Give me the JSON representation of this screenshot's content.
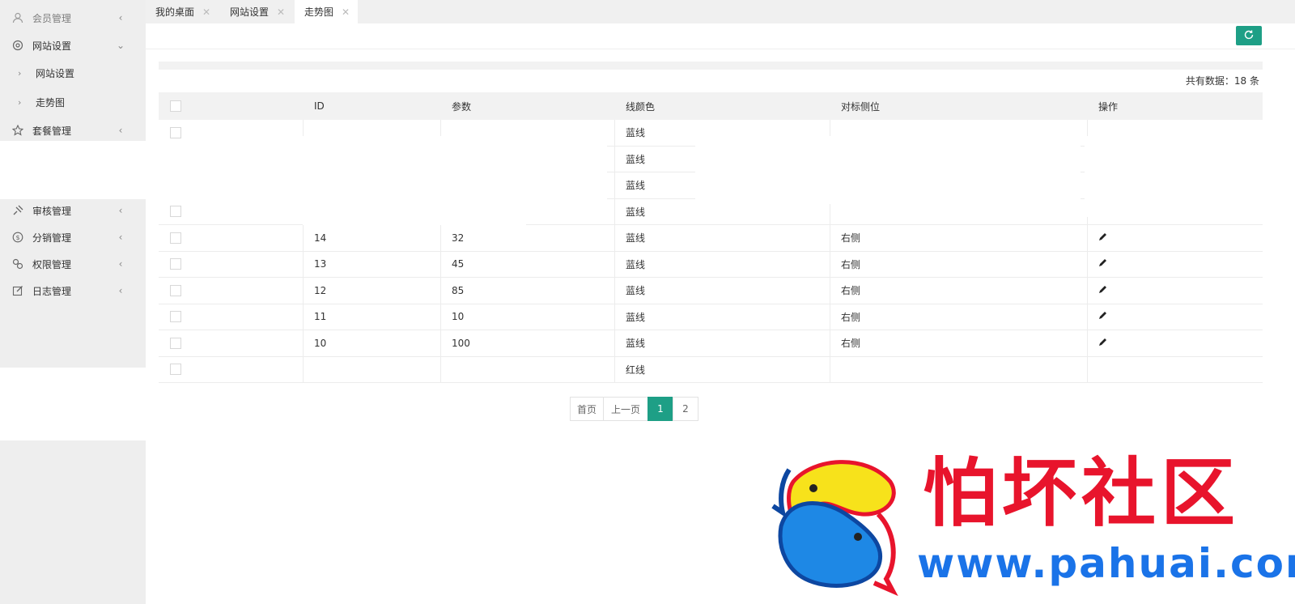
{
  "sidebar": {
    "items": [
      {
        "label": "会员管理",
        "icon": "user-icon"
      },
      {
        "label": "网站设置",
        "icon": "gear-icon",
        "expanded": true,
        "children": [
          {
            "label": "网站设置"
          },
          {
            "label": "走势图"
          }
        ]
      },
      {
        "label": "套餐管理",
        "icon": "star-icon"
      },
      {
        "label": "审核管理",
        "icon": "audit-icon"
      },
      {
        "label": "分销管理",
        "icon": "dollar-icon"
      },
      {
        "label": "权限管理",
        "icon": "link-icon"
      },
      {
        "label": "日志管理",
        "icon": "edit-log-icon"
      }
    ],
    "arrow_collapsed": "‹",
    "arrow_expanded": "⌄",
    "child_chevron": "›"
  },
  "tabs": [
    {
      "label": "我的桌面",
      "active": false
    },
    {
      "label": "网站设置",
      "active": false
    },
    {
      "label": "走势图",
      "active": true
    }
  ],
  "tab_close": "✕",
  "total_text": "共有数据：18 条",
  "table": {
    "headers": [
      "ID",
      "参数",
      "线颜色",
      "对标侧位",
      "操作"
    ],
    "rows": [
      {
        "id": "",
        "param": "",
        "color": "蓝线",
        "side": "",
        "edit": false
      },
      {
        "id": "",
        "param": "",
        "color": "蓝线",
        "side": "",
        "edit": false
      },
      {
        "id": "",
        "param": "",
        "color": "蓝线",
        "side": "",
        "edit": false
      },
      {
        "id": "",
        "param": "",
        "color": "蓝线",
        "side": "",
        "edit": false
      },
      {
        "id": "14",
        "param": "32",
        "color": "蓝线",
        "side": "右侧",
        "edit": true
      },
      {
        "id": "13",
        "param": "45",
        "color": "蓝线",
        "side": "右侧",
        "edit": true
      },
      {
        "id": "12",
        "param": "85",
        "color": "蓝线",
        "side": "右侧",
        "edit": true
      },
      {
        "id": "11",
        "param": "10",
        "color": "蓝线",
        "side": "右侧",
        "edit": true
      },
      {
        "id": "10",
        "param": "100",
        "color": "蓝线",
        "side": "右侧",
        "edit": true
      },
      {
        "id": "",
        "param": "",
        "color": "红线",
        "side": "",
        "edit": false
      }
    ]
  },
  "pagination": {
    "first": "首页",
    "prev": "上一页",
    "pages": [
      "1",
      "2"
    ],
    "current": "1"
  },
  "watermark": {
    "title": "怕坏社区",
    "url": "www.pahuai.com"
  },
  "colors": {
    "accent": "#1e9f86",
    "watermark_red": "#e8142c",
    "watermark_blue": "#1a73e8"
  }
}
